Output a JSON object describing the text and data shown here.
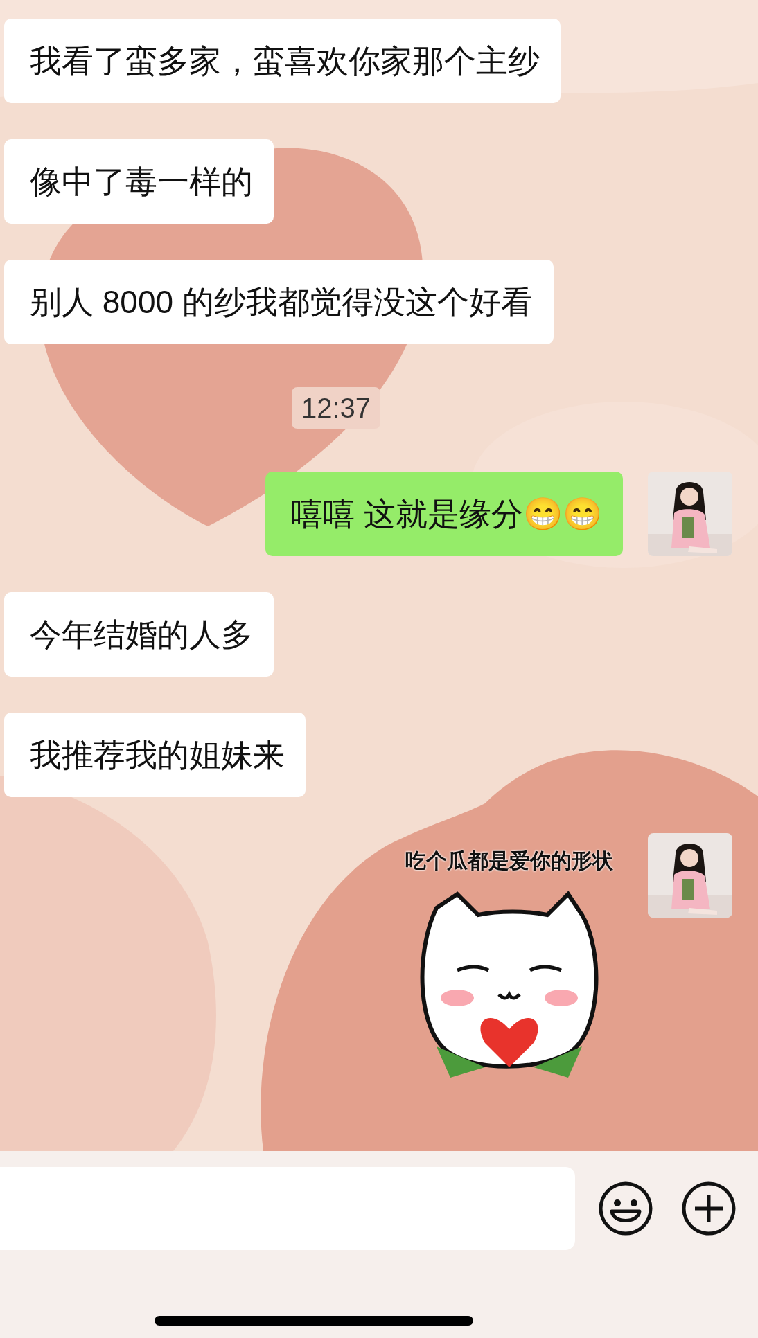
{
  "messages": [
    {
      "kind": "incoming",
      "text": "我看了蛮多家，蛮喜欢你家那个主纱"
    },
    {
      "kind": "incoming",
      "text": "像中了毒一样的"
    },
    {
      "kind": "incoming",
      "text": "别人 8000 的纱我都觉得没这个好看"
    },
    {
      "kind": "time",
      "text": "12:37"
    },
    {
      "kind": "outgoing",
      "text": "嘻嘻 这就是缘分😁😁"
    },
    {
      "kind": "incoming",
      "text": "今年结婚的人多"
    },
    {
      "kind": "incoming",
      "text": "我推荐我的姐妹来"
    },
    {
      "kind": "sticker",
      "text": "吃个瓜都是爱你的形状"
    }
  ]
}
